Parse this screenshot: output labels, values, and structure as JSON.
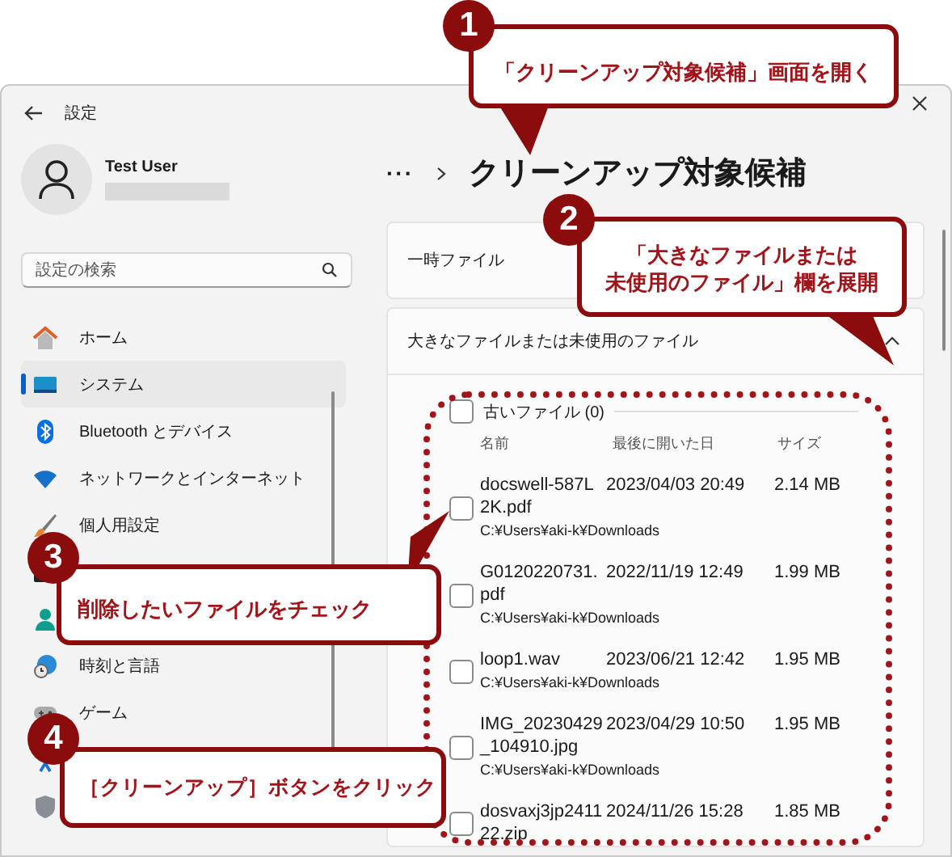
{
  "window": {
    "title": "設定"
  },
  "user": {
    "name": "Test User"
  },
  "search": {
    "placeholder": "設定の検索"
  },
  "sidebar": {
    "items": [
      {
        "label": "ホーム",
        "selected": false
      },
      {
        "label": "システム",
        "selected": true
      },
      {
        "label": "Bluetooth とデバイス",
        "selected": false
      },
      {
        "label": "ネットワークとインターネット",
        "selected": false
      },
      {
        "label": "個人用設定",
        "selected": false
      },
      {
        "selected": false
      },
      {
        "selected": false
      },
      {
        "label": "時刻と言語",
        "selected": false
      },
      {
        "label": "ゲーム",
        "selected": false
      },
      {
        "selected": false
      },
      {
        "selected": false
      }
    ]
  },
  "breadcrumb": {
    "more": "···",
    "title": "クリーンアップ対象候補"
  },
  "sections": [
    {
      "label": "一時ファイル",
      "expanded": false
    },
    {
      "label": "大きなファイルまたは未使用のファイル",
      "expanded": true,
      "group": {
        "label": "古いファイル (0)",
        "checked": false
      },
      "columns": [
        "名前",
        "最後に開いた日",
        "サイズ"
      ],
      "files": [
        {
          "name": "docswell-587L2K.pdf",
          "date": "2023/04/03 20:49",
          "size": "2.14 MB",
          "path": "C:¥Users¥aki-k¥Downloads",
          "checked": false
        },
        {
          "name": "G0120220731.pdf",
          "date": "2022/11/19 12:49",
          "size": "1.99 MB",
          "path": "C:¥Users¥aki-k¥Downloads",
          "checked": false
        },
        {
          "name": "loop1.wav",
          "date": "2023/06/21 12:42",
          "size": "1.95 MB",
          "path": "C:¥Users¥aki-k¥Downloads",
          "checked": false
        },
        {
          "name": "IMG_20230429_104910.jpg",
          "date": "2023/04/29 10:50",
          "size": "1.95 MB",
          "path": "C:¥Users¥aki-k¥Downloads",
          "checked": false
        },
        {
          "name": "dosvaxj3jp241122.zip",
          "date": "2024/11/26 15:28",
          "size": "1.85 MB",
          "checked": false
        }
      ]
    }
  ],
  "annotations": [
    {
      "number": "1",
      "text": "「クリーンアップ対象候補」画面を開く"
    },
    {
      "number": "2",
      "lines": [
        "「大きなファイルまたは",
        "未使用のファイル」欄を展開"
      ]
    },
    {
      "number": "3",
      "text": "削除したいファイルをチェック"
    },
    {
      "number": "4",
      "text": "［クリーンアップ］ボタンをクリック"
    }
  ]
}
